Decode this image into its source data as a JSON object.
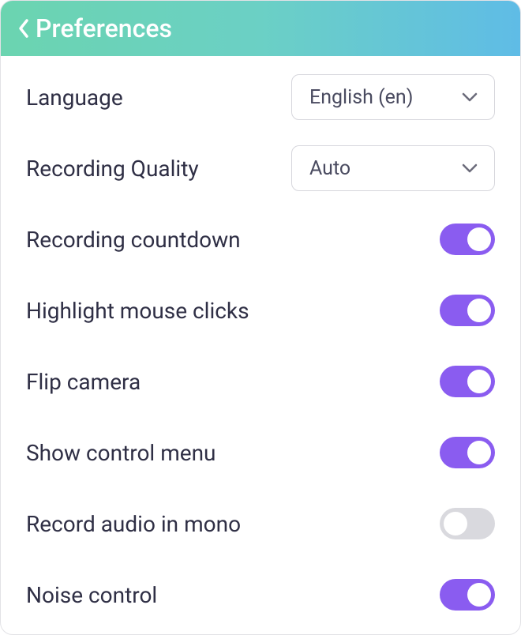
{
  "header": {
    "title": "Preferences"
  },
  "rows": {
    "language": {
      "label": "Language",
      "value": "English (en)"
    },
    "quality": {
      "label": "Recording Quality",
      "value": "Auto"
    },
    "countdown": {
      "label": "Recording countdown",
      "on": true
    },
    "highlight": {
      "label": "Highlight mouse clicks",
      "on": true
    },
    "flip": {
      "label": "Flip camera",
      "on": true
    },
    "controlmenu": {
      "label": "Show control menu",
      "on": true
    },
    "mono": {
      "label": "Record audio in mono",
      "on": false
    },
    "noise": {
      "label": "Noise control",
      "on": true
    }
  }
}
